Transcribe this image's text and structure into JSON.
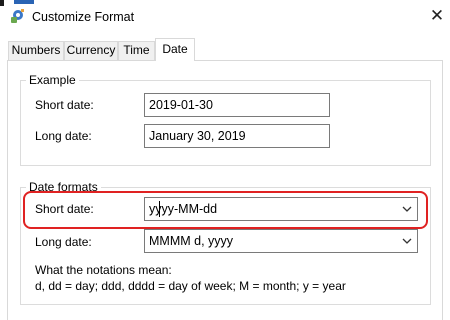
{
  "window": {
    "title": "Customize Format",
    "close_glyph": "✕",
    "icon": "customize-format-app-icon",
    "partial_top_text": "..."
  },
  "tabs": [
    {
      "label": "Numbers",
      "active": false
    },
    {
      "label": "Currency",
      "active": false
    },
    {
      "label": "Time",
      "active": false
    },
    {
      "label": "Date",
      "active": true
    }
  ],
  "example": {
    "title": "Example",
    "short_label": "Short date:",
    "short_value": "2019-01-30",
    "long_label": "Long date:",
    "long_value": "January 30, 2019"
  },
  "formats": {
    "title": "Date formats",
    "short_label": "Short date:",
    "short_value": "yyyy-MM-dd",
    "long_label": "Long date:",
    "long_value": "MMMM d, yyyy",
    "notes_title": "What the notations mean:",
    "notes_text": "d, dd = day;  ddd, dddd = day of week;  M = month;  y = year"
  },
  "colors": {
    "highlight": "#e02222",
    "accent_blue": "#2a64b4"
  }
}
